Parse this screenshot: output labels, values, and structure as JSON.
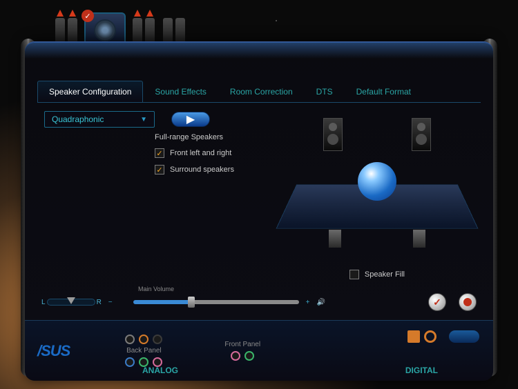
{
  "tabs": [
    {
      "label": "Speaker Configuration",
      "active": true
    },
    {
      "label": "Sound Effects",
      "active": false
    },
    {
      "label": "Room Correction",
      "active": false
    },
    {
      "label": "DTS",
      "active": false
    },
    {
      "label": "Default Format",
      "active": false
    }
  ],
  "config": {
    "mode": "Quadraphonic",
    "section_label": "Full-range Speakers",
    "options": {
      "front_lr": {
        "label": "Front left and right",
        "checked": true
      },
      "surround": {
        "label": "Surround speakers",
        "checked": true
      }
    },
    "speaker_fill": {
      "label": "Speaker Fill",
      "checked": false
    }
  },
  "volume": {
    "label": "Main Volume",
    "balance_left": "L",
    "balance_right": "R",
    "minus": "−",
    "plus": "+"
  },
  "footer": {
    "brand": "/SUS",
    "back_panel": "Back Panel",
    "front_panel": "Front Panel",
    "analog": "ANALOG",
    "digital": "DIGITAL"
  }
}
